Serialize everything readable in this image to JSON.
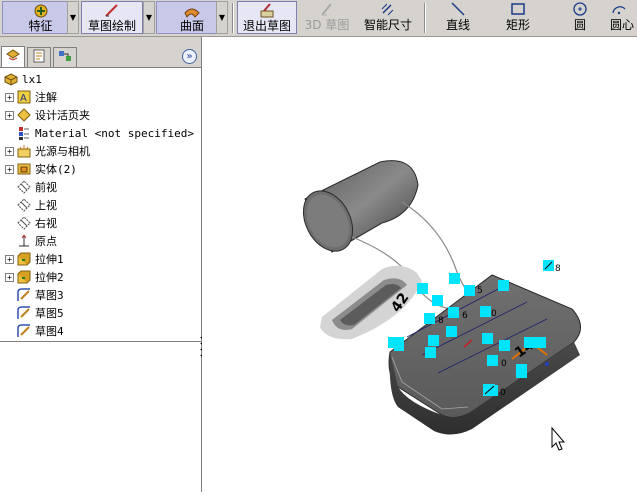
{
  "toolbar": {
    "features_label": "特征",
    "sketch_draw_label": "草图绘制",
    "surface_label": "曲面",
    "exit_sketch_label": "退出草图",
    "sketch3d_label": "3D 草图",
    "smart_dim_label": "智能尺寸",
    "line_label": "直线",
    "rect_label": "矩形",
    "circle_label": "圆",
    "center_arc_label": "圆心"
  },
  "panel": {
    "collapse_glyph": "»",
    "root_label": "lx1",
    "items": [
      {
        "label": "注解",
        "icon": "annotation-icon",
        "expandable": true
      },
      {
        "label": "设计活页夹",
        "icon": "design-binder-icon",
        "expandable": true
      },
      {
        "label": "Material <not specified>",
        "icon": "material-icon",
        "expandable": false
      },
      {
        "label": "光源与相机",
        "icon": "lights-icon",
        "expandable": true
      },
      {
        "label": "实体(2)",
        "icon": "solid-bodies-icon",
        "expandable": true
      },
      {
        "label": "前视",
        "icon": "plane-icon",
        "expandable": false
      },
      {
        "label": "上视",
        "icon": "plane-icon",
        "expandable": false
      },
      {
        "label": "右视",
        "icon": "plane-icon",
        "expandable": false
      },
      {
        "label": "原点",
        "icon": "origin-icon",
        "expandable": false
      },
      {
        "label": "拉伸1",
        "icon": "extrude-icon",
        "expandable": true
      },
      {
        "label": "拉伸2",
        "icon": "extrude-icon",
        "expandable": true
      },
      {
        "label": "草图3",
        "icon": "sketch-icon",
        "expandable": false
      },
      {
        "label": "草图5",
        "icon": "sketch-icon",
        "expandable": false
      },
      {
        "label": "草图4",
        "icon": "sketch-icon",
        "expandable": false
      }
    ]
  },
  "viewport": {
    "relation_labels": [
      "8",
      "5",
      "8",
      "6",
      "0",
      "0",
      "0"
    ],
    "dimension_labels": [
      "42",
      "14"
    ]
  },
  "colors": {
    "toolbar_bg": "#d6d3ce",
    "relation_marker": "#00e5ff",
    "body_gray": "#6e6e6e",
    "selection_orange": "#e07000"
  }
}
